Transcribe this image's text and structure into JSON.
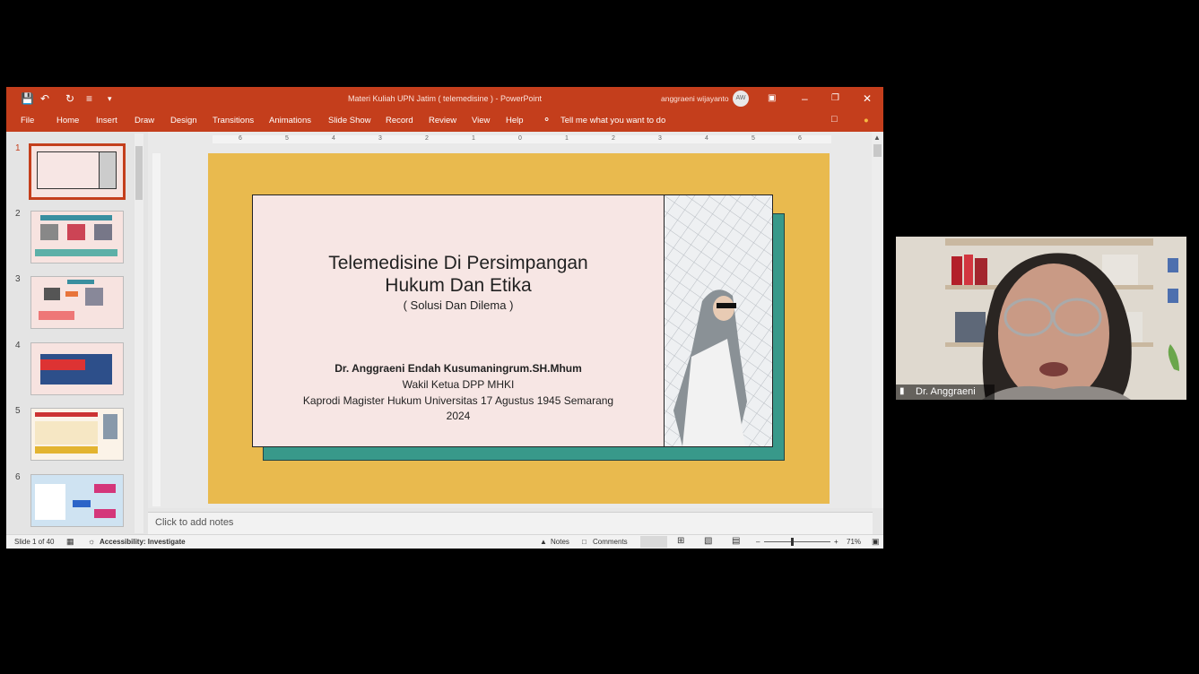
{
  "window": {
    "doc_title": "Materi Kuliah UPN Jatim ( telemedisine ) - PowerPoint",
    "user_name": "anggraeni wijayanto",
    "user_initials": "AW"
  },
  "ribbon": {
    "tabs": [
      "File",
      "Home",
      "Insert",
      "Draw",
      "Design",
      "Transitions",
      "Animations",
      "Slide Show",
      "Record",
      "Review",
      "View",
      "Help"
    ],
    "tell_me": "Tell me what you want to do"
  },
  "thumbnails": [
    "1",
    "2",
    "3",
    "4",
    "5",
    "6"
  ],
  "ruler": [
    "6",
    "5",
    "4",
    "3",
    "2",
    "1",
    "0",
    "1",
    "2",
    "3",
    "4",
    "5",
    "6"
  ],
  "slide": {
    "title_line1": "Telemedisine Di Persimpangan",
    "title_line2": "Hukum Dan Etika",
    "subtitle": "( Solusi Dan Dilema )",
    "author": "Dr. Anggraeni Endah Kusumaningrum.SH.Mhum",
    "role1": "Wakil Ketua DPP MHKI",
    "role2": "Kaprodi Magister Hukum Universitas 17 Agustus 1945 Semarang",
    "year": "2024"
  },
  "notes_placeholder": "Click to add notes",
  "status": {
    "slide_count": "Slide 1 of 40",
    "accessibility": "Accessibility: Investigate",
    "notes": "Notes",
    "comments": "Comments",
    "zoom": "71%",
    "zoom_level": 0.42
  },
  "webcam": {
    "participant_name": "Dr. Anggraeni"
  },
  "colors": {
    "accent": "#c43e1c",
    "slide_bg": "#e9ba4e",
    "teal": "#38998a"
  }
}
